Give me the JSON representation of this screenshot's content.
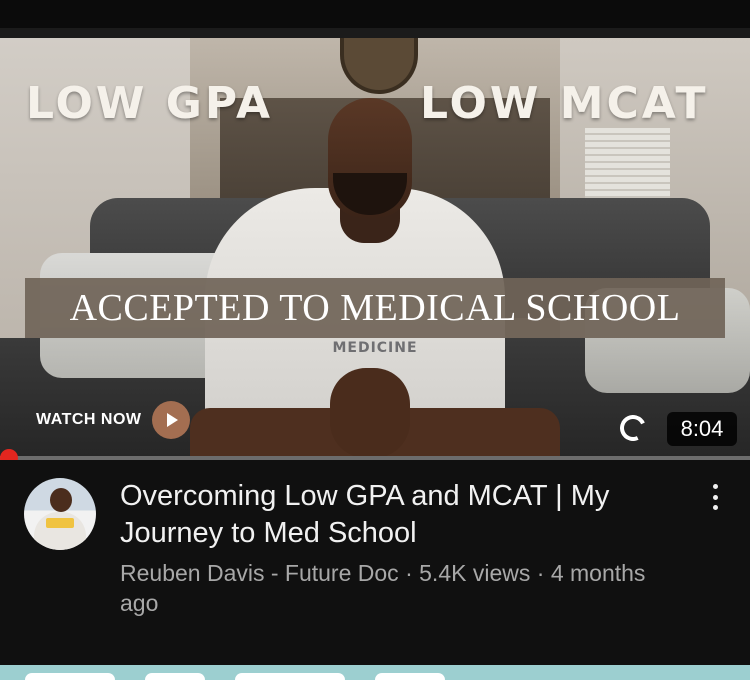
{
  "video": {
    "thumbnail": {
      "headline_left": "LOW GPA",
      "headline_right": "LOW MCAT",
      "banner": "ACCEPTED TO MEDICAL SCHOOL",
      "shirt_text": "MEDICINE",
      "watch_now_label": "WATCH NOW",
      "duration": "8:04"
    },
    "progress": {
      "fraction": 0.0
    },
    "title": "Overcoming Low GPA and MCAT | My Journey to Med School",
    "channel": "Reuben Davis - Future Doc",
    "views": "5.4K views",
    "age": "4 months ago",
    "separator": " · "
  },
  "colors": {
    "background": "#101010",
    "progress_red": "#e3261f",
    "banner": "#706458",
    "play_button": "#a36e51",
    "next_thumbnail": "#9ccfd0"
  },
  "icons": {
    "play": "play-icon",
    "loading": "loading-spinner-icon",
    "more": "more-vertical-icon"
  }
}
